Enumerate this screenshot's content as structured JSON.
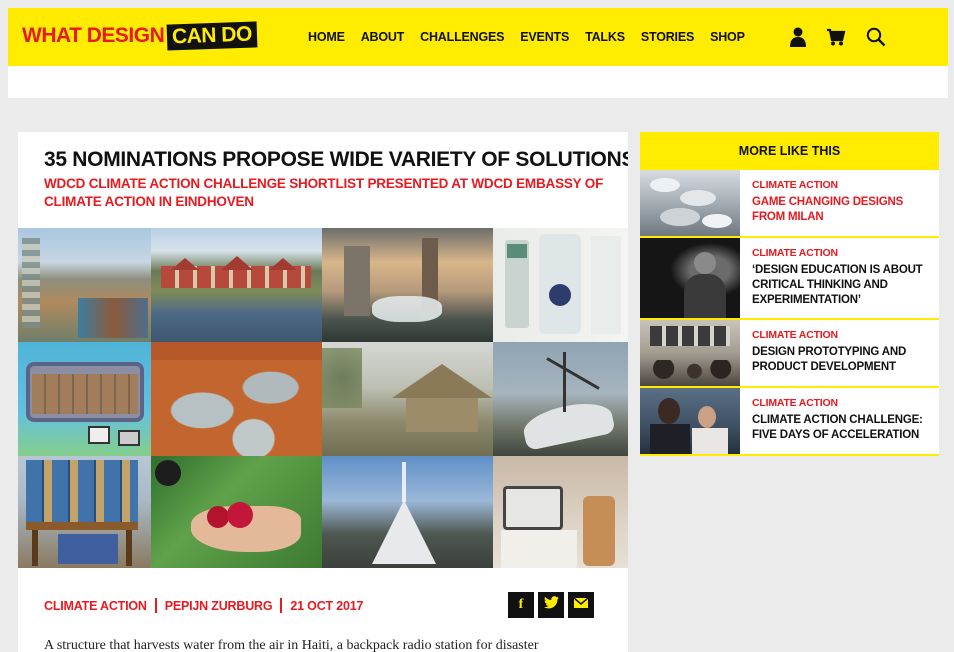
{
  "header": {
    "logo_part1": "WHAT DESIGN",
    "logo_part2": "CAN DO",
    "nav": [
      {
        "label": "HOME"
      },
      {
        "label": "ABOUT"
      },
      {
        "label": "CHALLENGES"
      },
      {
        "label": "EVENTS"
      },
      {
        "label": "TALKS"
      },
      {
        "label": "STORIES"
      },
      {
        "label": "SHOP"
      }
    ],
    "icons": [
      "user-icon",
      "cart-icon",
      "search-icon"
    ]
  },
  "article": {
    "title": "35 NOMINATIONS PROPOSE WIDE VARIETY OF SOLUTIONS",
    "subtitle": "WDCD CLIMATE ACTION CHALLENGE SHORTLIST PRESENTED AT WDCD EMBASSY OF CLIMATE ACTION IN EINDHOVEN",
    "meta": {
      "category": "CLIMATE ACTION",
      "author": "PEPIJN ZURBURG",
      "date": "21 OCT 2017"
    },
    "share": {
      "facebook": "f",
      "twitter": "t",
      "email": "✉"
    },
    "body_preview": "A structure that harvests water from the air in Haiti, a backpack radio station for disaster"
  },
  "sidebar": {
    "heading": "MORE LIKE THIS",
    "items": [
      {
        "category": "CLIMATE ACTION",
        "title": "GAME CHANGING DESIGNS FROM MILAN",
        "title_red": true
      },
      {
        "category": "CLIMATE ACTION",
        "title": "‘DESIGN EDUCATION IS ABOUT CRITICAL THINKING AND EXPERIMENTATION’",
        "title_red": false
      },
      {
        "category": "CLIMATE ACTION",
        "title": "DESIGN PROTOTYPING AND PRODUCT DEVELOPMENT",
        "title_red": false
      },
      {
        "category": "CLIMATE ACTION",
        "title": "CLIMATE ACTION CHALLENGE: FIVE DAYS OF ACCELERATION",
        "title_red": false
      }
    ]
  },
  "colors": {
    "brand_yellow": "#ffec00",
    "brand_red": "#e8191f",
    "text_dark": "#111111"
  }
}
